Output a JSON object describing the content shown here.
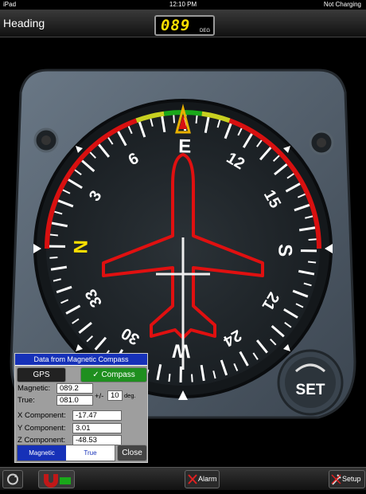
{
  "status": {
    "device": "iPad",
    "time": "12:10 PM",
    "battery": "Not Charging"
  },
  "header": {
    "title": "Heading",
    "heading_value": "089",
    "heading_unit": "DEG"
  },
  "compass": {
    "labels": [
      "N",
      "3",
      "6",
      "E",
      "12",
      "15",
      "S",
      "21",
      "24",
      "W",
      "30",
      "33"
    ],
    "set_label": "SET",
    "heading_deg": 89
  },
  "panel": {
    "title": "Data from Magnetic Compass",
    "gps_label": "GPS",
    "compass_label": "✓ Compass",
    "magnetic_label": "Magnetic:",
    "magnetic_value": "089.2",
    "true_label": "True:",
    "true_value": "081.0",
    "pm_label": "+/-",
    "pm_value": "10",
    "deg_label": "deg.",
    "x_label": "X Component:",
    "x_value": "-17.47",
    "y_label": "Y Component:",
    "y_value": "3.01",
    "z_label": "Z Component:",
    "z_value": "-48.53",
    "seg_magnetic": "Magnetic",
    "seg_true": "True",
    "close_label": "Close"
  },
  "bottom": {
    "alarm_label": "Alarm",
    "setup_label": "Setup"
  },
  "colors": {
    "accent_yellow": "#ffe000",
    "arc_red": "#d81010",
    "arc_green": "#1aa81a",
    "arc_yellow": "#c8d020",
    "panel_blue": "#1631b8"
  }
}
